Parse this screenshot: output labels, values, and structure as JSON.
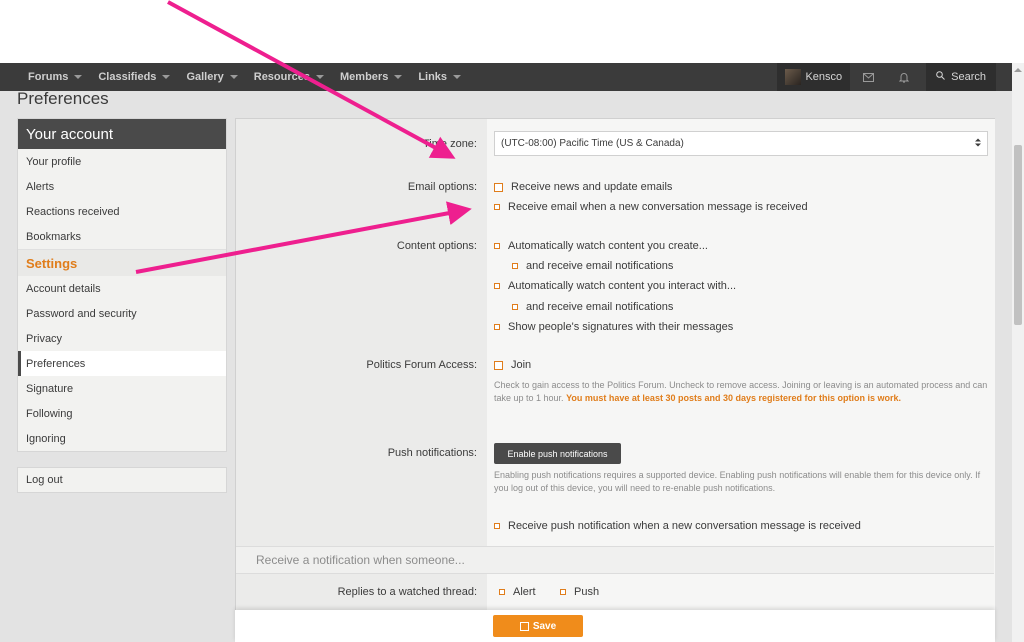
{
  "nav": {
    "items": [
      "Forums",
      "Classifieds",
      "Gallery",
      "Resources",
      "Members",
      "Links"
    ],
    "username": "Kensco",
    "search_label": "Search",
    "search_icon": "search-icon",
    "mail_icon": "envelope-icon",
    "bell_icon": "bell-icon"
  },
  "page": {
    "title": "Preferences"
  },
  "sidebar": {
    "header": "Your account",
    "account_items": [
      "Your profile",
      "Alerts",
      "Reactions received",
      "Bookmarks"
    ],
    "settings_header": "Settings",
    "settings_items": [
      "Account details",
      "Password and security",
      "Privacy",
      "Preferences",
      "Signature",
      "Following",
      "Ignoring"
    ],
    "active_item": "Preferences",
    "logout": "Log out"
  },
  "form": {
    "timezone_label": "Time zone:",
    "timezone_value": "(UTC-08:00) Pacific Time (US & Canada)",
    "email_label": "Email options:",
    "email_options": [
      "Receive news and update emails",
      "Receive email when a new conversation message is received"
    ],
    "content_label": "Content options:",
    "content_options": [
      "Automatically watch content you create...",
      "and receive email notifications",
      "Automatically watch content you interact with...",
      "and receive email notifications",
      "Show people's signatures with their messages"
    ],
    "politics_label": "Politics Forum Access:",
    "politics_option": "Join",
    "politics_hint": "Check to gain access to the Politics Forum. Uncheck to remove access. Joining or leaving is an automated process and can take up to 1 hour.",
    "politics_hint_bold": "You must have at least 30 posts and 30 days registered for this option is work.",
    "push_label": "Push notifications:",
    "push_button": "Enable push notifications",
    "push_hint": "Enabling push notifications requires a supported device. Enabling push notifications will enable them for this device only. If you log out of this device, you will need to re-enable push notifications.",
    "push_option": "Receive push notification when a new conversation message is received",
    "notify_section": "Receive a notification when someone...",
    "replies_label": "Replies to a watched thread:",
    "replies_alert": "Alert",
    "replies_push": "Push",
    "save_button": "Save"
  },
  "colors": {
    "accent": "#e07d1b",
    "nav_bg": "#3b3b3b",
    "arrow": "#ee1f8f"
  }
}
